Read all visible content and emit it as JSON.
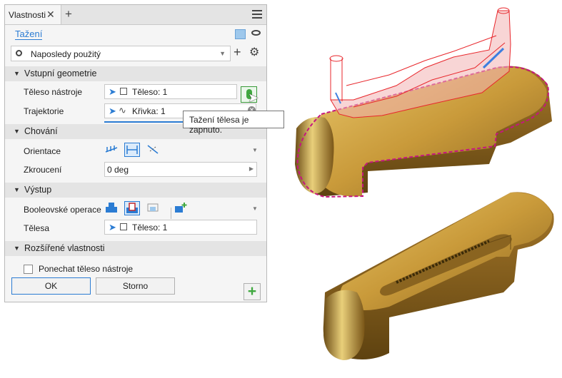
{
  "window": {
    "tab_label": "Vlastnosti"
  },
  "header": {
    "command_title": "Tažení",
    "preset_value": "Naposledy použitý"
  },
  "sections": {
    "input": "Vstupní geometrie",
    "behavior": "Chování",
    "output": "Výstup",
    "advanced": "Rozšířené vlastnosti"
  },
  "rows": {
    "tool_body_label": "Těleso nástroje",
    "tool_body_value": "Těleso: 1",
    "trajectory_label": "Trajektorie",
    "trajectory_value": "Křivka: 1",
    "orientation_label": "Orientace",
    "twist_label": "Zkroucení",
    "twist_value": "0 deg",
    "boolean_label": "Booleovské operace",
    "bodies_label": "Tělesa",
    "bodies_value": "Těleso: 1",
    "keep_tool_label": "Ponechat těleso nástroje"
  },
  "tooltip": "Tažení tělesa je zapnuto.",
  "buttons": {
    "ok": "OK",
    "cancel": "Storno"
  },
  "colors": {
    "accent": "#2b7cd3",
    "active_green": "#3fa83f",
    "preview_red": "#e8262b",
    "bronze": "#b8862a",
    "selection_magenta": "#c5167f"
  }
}
